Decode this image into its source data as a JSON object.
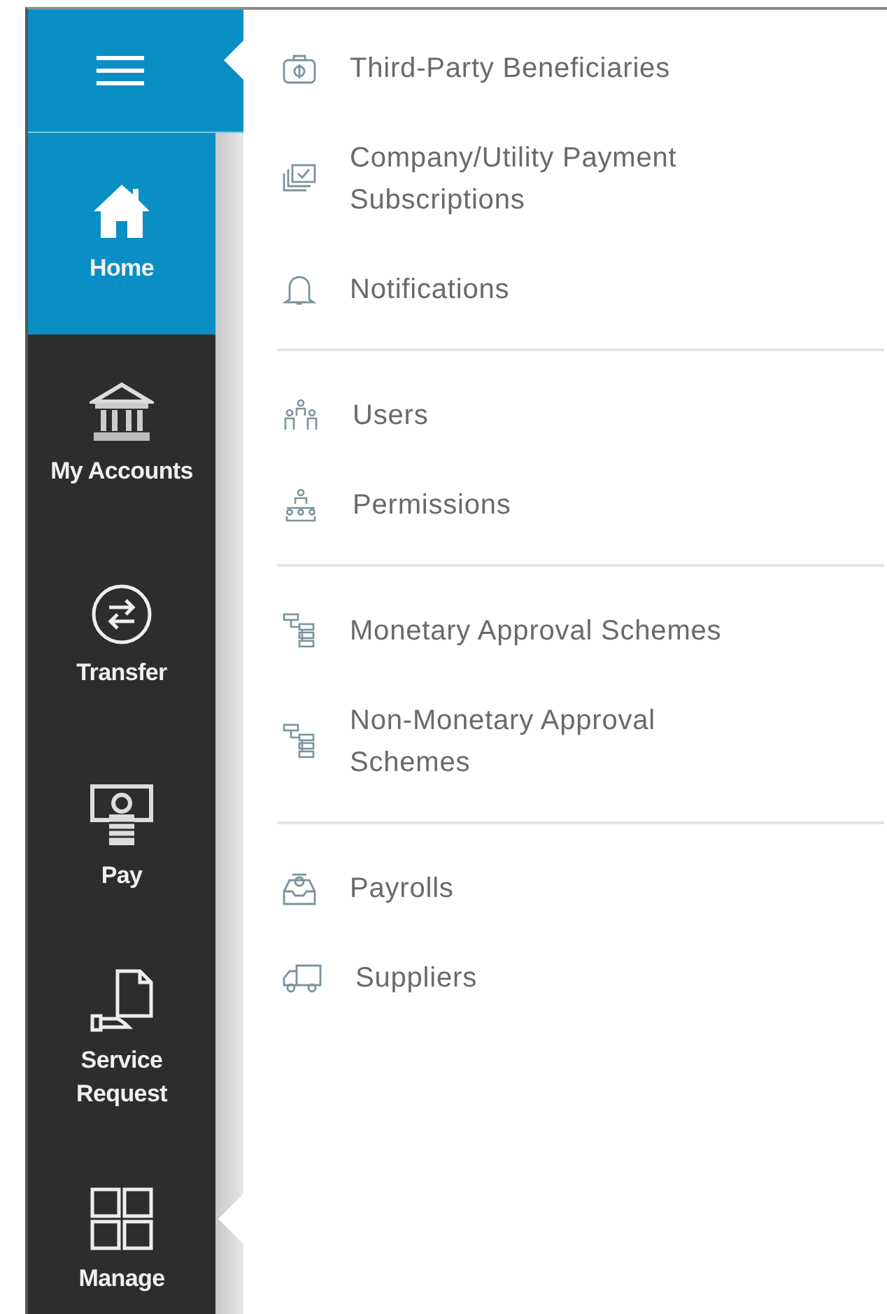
{
  "sidebar": {
    "items": [
      {
        "label": "Home",
        "kind": "home",
        "selected": true,
        "open": false
      },
      {
        "label": "My Accounts",
        "kind": "bank",
        "selected": false,
        "open": false
      },
      {
        "label": "Transfer",
        "kind": "transfer",
        "selected": false,
        "open": false
      },
      {
        "label": "Pay",
        "kind": "pay",
        "selected": false,
        "open": false
      },
      {
        "label": "Service Request",
        "kind": "document-hand",
        "selected": false,
        "open": false
      },
      {
        "label": "Manage",
        "kind": "grid",
        "selected": false,
        "open": true
      }
    ]
  },
  "menu": {
    "groups": [
      {
        "items": [
          {
            "label": "Third-Party Beneficiaries",
            "kind": "briefcase"
          },
          {
            "label": "Company/Utility Payment Subscriptions",
            "kind": "stack"
          },
          {
            "label": "Notifications",
            "kind": "bell"
          }
        ]
      },
      {
        "items": [
          {
            "label": "Users",
            "kind": "users"
          },
          {
            "label": "Permissions",
            "kind": "hierarchy"
          }
        ]
      },
      {
        "items": [
          {
            "label": "Monetary Approval Schemes",
            "kind": "steps"
          },
          {
            "label": "Non-Monetary Approval Schemes",
            "kind": "steps"
          }
        ]
      },
      {
        "items": [
          {
            "label": "Payrolls",
            "kind": "payroll"
          },
          {
            "label": "Suppliers",
            "kind": "truck"
          }
        ]
      }
    ]
  }
}
